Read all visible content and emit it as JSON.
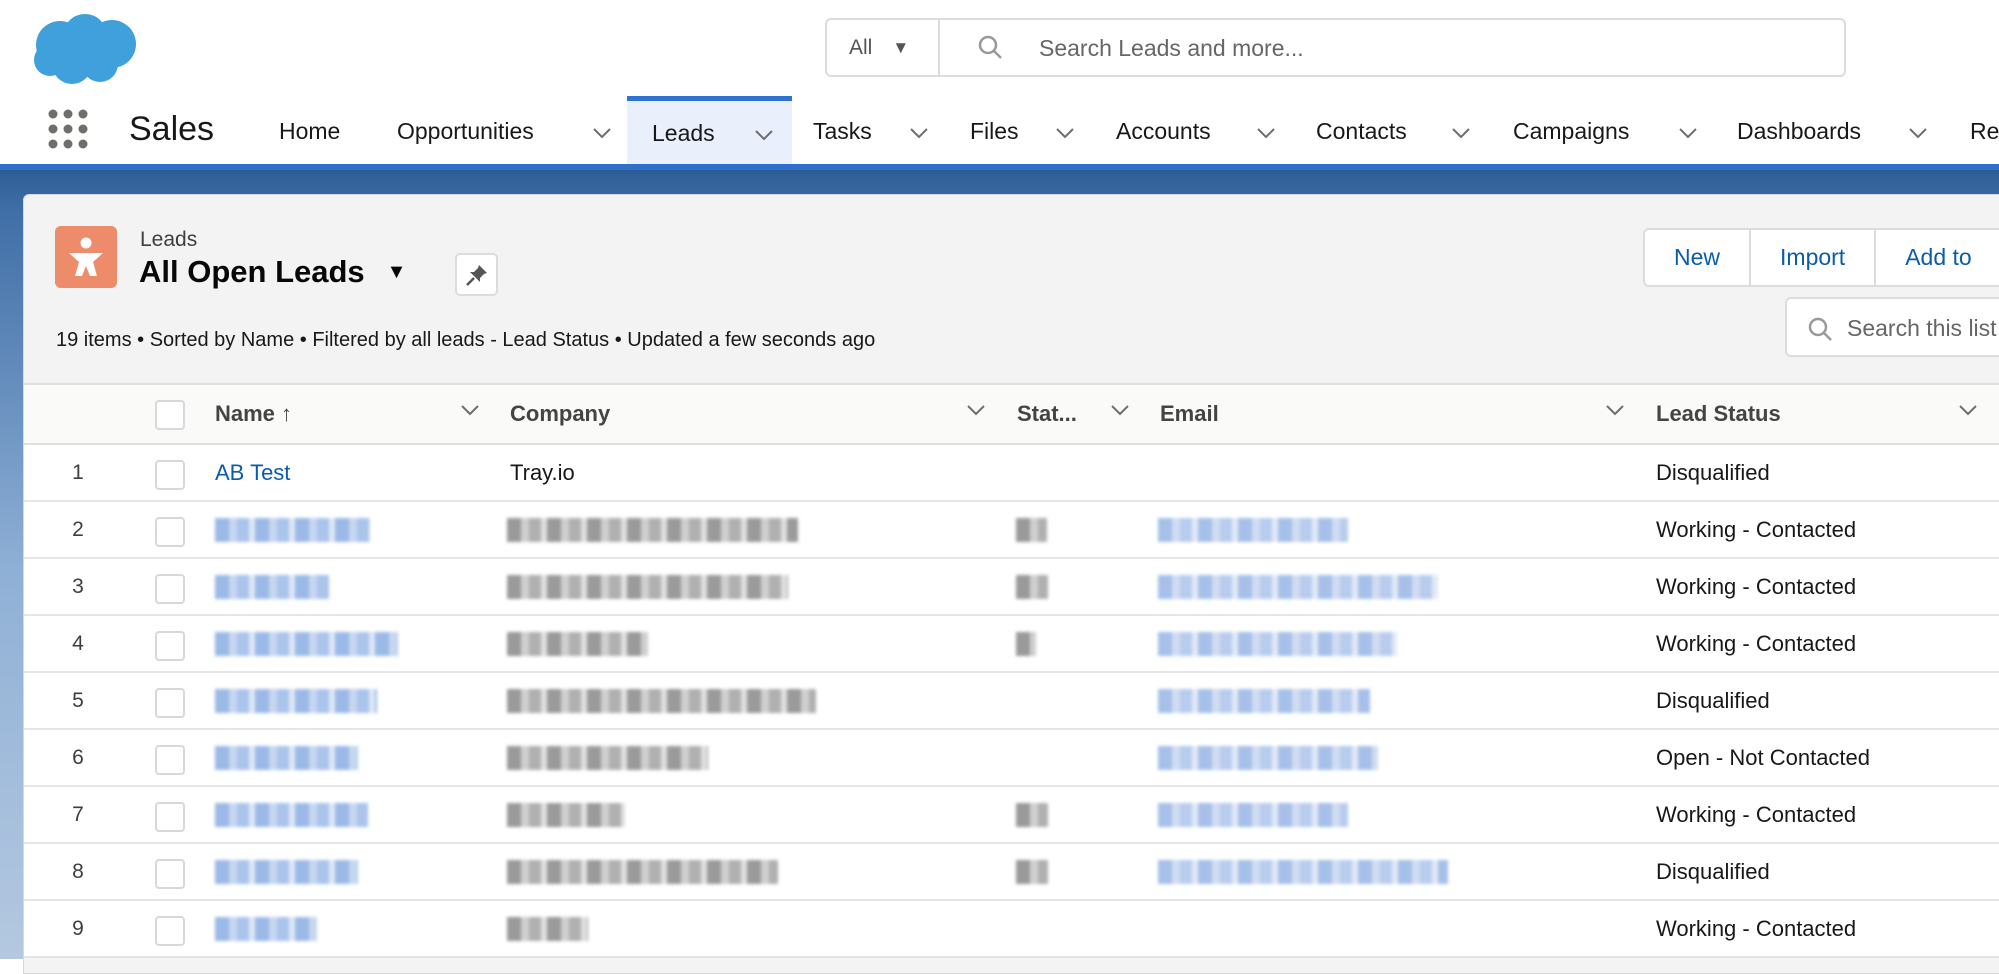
{
  "header": {
    "search": {
      "scope": "All",
      "placeholder": "Search Leads and more..."
    },
    "app_name": "Sales",
    "nav": [
      {
        "label": "Home",
        "has_menu": false
      },
      {
        "label": "Opportunities",
        "has_menu": true
      },
      {
        "label": "Leads",
        "has_menu": true,
        "active": true
      },
      {
        "label": "Tasks",
        "has_menu": true
      },
      {
        "label": "Files",
        "has_menu": true
      },
      {
        "label": "Accounts",
        "has_menu": true
      },
      {
        "label": "Contacts",
        "has_menu": true
      },
      {
        "label": "Campaigns",
        "has_menu": true
      },
      {
        "label": "Dashboards",
        "has_menu": true
      },
      {
        "label": "Re",
        "has_menu": false
      }
    ]
  },
  "list": {
    "object_label": "Leads",
    "title": "All Open Leads",
    "info": "19 items • Sorted by Name • Filtered by all leads - Lead Status • Updated a few seconds ago",
    "buttons": [
      "New",
      "Import",
      "Add to"
    ],
    "search_placeholder": "Search this list",
    "columns": [
      "Name ↑",
      "Company",
      "Stat...",
      "Email",
      "Lead Status"
    ],
    "accent_color": "#0b5cab",
    "rows": [
      {
        "num": "1",
        "name": "AB Test",
        "company": "Tray.io",
        "state": "",
        "email": "",
        "status": "Disqualified"
      },
      {
        "num": "2",
        "status": "Working - Contacted",
        "redacted": true
      },
      {
        "num": "3",
        "status": "Working - Contacted",
        "redacted": true
      },
      {
        "num": "4",
        "status": "Working - Contacted",
        "redacted": true
      },
      {
        "num": "5",
        "status": "Disqualified",
        "redacted": true
      },
      {
        "num": "6",
        "status": "Open - Not Contacted",
        "redacted": true
      },
      {
        "num": "7",
        "status": "Working - Contacted",
        "redacted": true
      },
      {
        "num": "8",
        "status": "Disqualified",
        "redacted": true
      },
      {
        "num": "9",
        "status": "Working - Contacted",
        "redacted": true
      }
    ]
  }
}
